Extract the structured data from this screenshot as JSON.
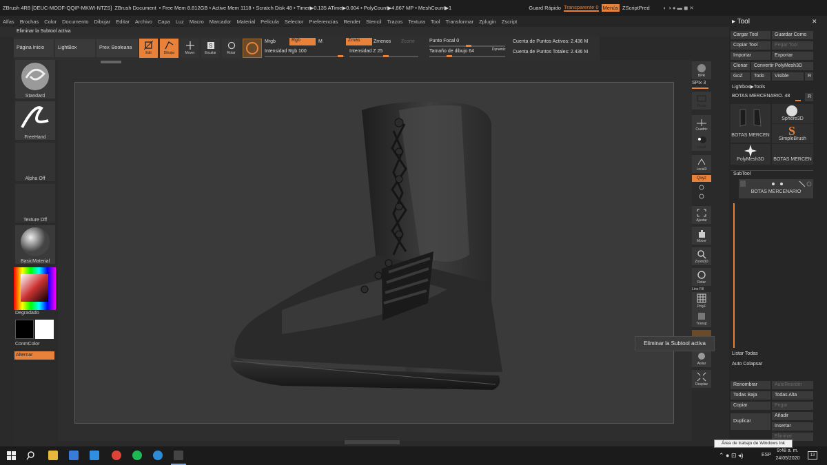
{
  "titlebar": {
    "app": "ZBrush 4R8 [DEUC-MODF-QQIP-MKWI-NTZS]",
    "doc": "ZBrush Document",
    "freemem": "• Free Mem 8.812GB • Active Mem 1118 • Scratch Disk 48 • Timer▶0.135 ATime▶0.004 • PolyCount▶4.867 MP • MeshCount▶1",
    "guardar": "Guard Rápido",
    "transparente": "Transparente 0",
    "menus": "Menús",
    "zscript": "ZScriptPred"
  },
  "menus": [
    "Alfas",
    "Brochas",
    "Color",
    "Documento",
    "Dibujar",
    "Editar",
    "Archivo",
    "Capa",
    "Luz",
    "Macro",
    "Marcador",
    "Material",
    "Película",
    "Selector",
    "Preferencias",
    "Render",
    "Stencil",
    "Trazos",
    "Textura",
    "Tool",
    "Transformar",
    "Zplugin",
    "Zscript"
  ],
  "status": "Eliminar la Subtool activa",
  "shelf": {
    "home": "Página Inicio",
    "lightbox": "LightBox",
    "boolean": "Prev. Booleana",
    "edit": "Edit",
    "draw": "Dibujar",
    "move": "Mover",
    "scale": "Escalar",
    "rotate": "Rotar",
    "mrgb": "Mrgb",
    "rgb": "Rgb",
    "m": "M",
    "zadd": "Zmás",
    "zsub": "Zmenos",
    "zcut": "Zcorte",
    "rgb_intensity": "Intensidad Rgb 100",
    "z_intensity": "Intensidad Z 25",
    "focal": "Punto Focal 0",
    "draw_size": "Tamaño de dibujo 64",
    "dynamic": "Dynamic",
    "active_points": "Cuenta de Puntos Activos: 2.436 M",
    "total_points": "Cuenta de Puntos Totales: 2.436 M"
  },
  "lefttray": {
    "standard": "Standard",
    "freehand": "FreeHand",
    "alpha": "Alpha Off",
    "texture": "Texture Off",
    "material": "BasicMaterial",
    "gradient": "Degradado",
    "switchcolor": "ConmColor",
    "alternate": "Alternar"
  },
  "righttray": {
    "bpr": "BPR",
    "spix": "SPix 3",
    "persp": "Persp",
    "floor": "Cuadric",
    "local": "Local",
    "l_sym": "Local3",
    "xyz": "Qxyz",
    "frame": "Ajustar",
    "move": "Mover",
    "zoom": "Zoom3D",
    "rotate": "Rotar",
    "linefill": "Line Fill",
    "polyf": "PolyF",
    "transp": "Transp",
    "solo": "Aislar",
    "xpose": "Desplaz"
  },
  "tooltip": "Eliminar la Subtool activa",
  "toolpanel": {
    "title": "Tool",
    "load": "Cargar Tool",
    "save": "Guardar Como",
    "copy": "Copiar Tool",
    "paste": "Pegar Tool",
    "import": "Importar",
    "export": "Exportar",
    "clone": "Clonar",
    "polymesh": "Convertir PolyMesh3D",
    "goz": "GoZ",
    "all": "Todo",
    "visible": "Visible",
    "r": "R",
    "lightbox_tools": "Lightbox▶Tools",
    "current": "BOTAS MERCENARIO. 48",
    "thumbs": [
      "BOTAS MERCEN",
      "Sphere3D",
      "SimpleBrush",
      "PolyMesh3D",
      "BOTAS MERCEN"
    ],
    "subtool": "SubTool",
    "subtool_item": "BOTAS MERCENARIO",
    "list_all": "Listar Todas",
    "auto_collapse": "Auto Colapsar",
    "rename": "Renombrar",
    "autoreorder": "AutoReorder",
    "all_low": "Todas Baja",
    "all_high": "Todas Alta",
    "copy2": "Copiar",
    "paste2": "Pegar",
    "duplicate": "Duplicar",
    "append": "Añadir",
    "insert": "Insertar",
    "delete": "Eliminar"
  },
  "taskbar": {
    "ink_tip": "Área de trabajo de Windows Ink",
    "lang": "ESP",
    "time": "9:48 a. m.",
    "date": "24/05/2020",
    "notif": "13"
  },
  "colors": {
    "accent": "#e8823a",
    "bg": "#2a2a2a",
    "viewport": "#3a3a3a"
  }
}
